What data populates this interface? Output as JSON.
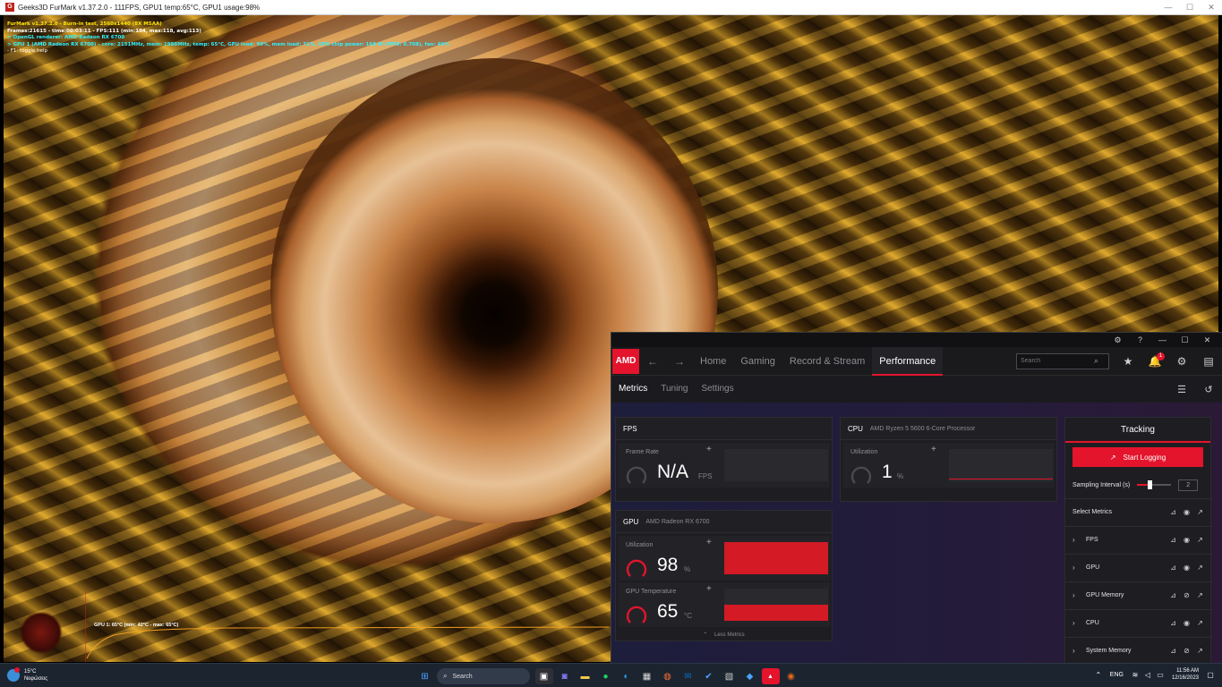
{
  "furmark": {
    "title": "Geeks3D FurMark v1.37.2.0 - 111FPS, GPU1 temp:65°C, GPU1 usage:98%",
    "hud": [
      "FurMark v1.37.2.0 - Burn-in test, 2560x1440 (8X MSAA)",
      "Frames:21615 - time:00:03:11 - FPS:111 (min:104, max:118, avg:113)",
      "> OpenGL renderer: AMD Radeon RX 6700",
      "> GPU 1 (AMD Radeon RX 6700) - core: 2151MHz, mem: 1988MHz, temp: 65°C, GPU load: 99%, mem load: 71%, GPU chip power: 168 W (PPW: 0.708), fan: 49%",
      "- F1: toggle help"
    ],
    "graph_caption": "GPU 1: 65°C (min: 42°C - max: 65°C)"
  },
  "amd": {
    "logo": "AMD",
    "nav": {
      "back": "←",
      "forward": "→",
      "tabs": [
        "Home",
        "Gaming",
        "Record & Stream",
        "Performance"
      ],
      "active_tab": "Performance",
      "search_placeholder": "Search",
      "notification_count": "1"
    },
    "subnav": {
      "tabs": [
        "Metrics",
        "Tuning",
        "Settings"
      ],
      "active_tab": "Metrics"
    },
    "fps_card": {
      "title": "FPS",
      "frame_rate_label": "Frame Rate",
      "frame_rate_value": "N/A",
      "frame_rate_unit": "FPS"
    },
    "cpu_card": {
      "title": "CPU",
      "subtitle": "AMD Ryzen 5 5600 6-Core Processor",
      "utilization_label": "Utilization",
      "utilization_value": "1",
      "utilization_unit": "%"
    },
    "gpu_card": {
      "title": "GPU",
      "subtitle": "AMD Radeon RX 6700",
      "utilization_label": "Utilization",
      "utilization_value": "98",
      "utilization_unit": "%",
      "temp_label": "GPU Temperature",
      "temp_value": "65",
      "temp_unit": "°C",
      "less_metrics": "Less Metrics"
    },
    "tracking": {
      "title": "Tracking",
      "start_logging": "Start Logging",
      "sampling_label": "Sampling Interval (s)",
      "sampling_value": "2",
      "select_metrics": "Select Metrics",
      "rows": [
        "FPS",
        "GPU",
        "GPU Memory",
        "CPU",
        "System Memory"
      ]
    },
    "accent_color": "#e3142c"
  },
  "taskbar": {
    "weather_temp": "15°C",
    "weather_desc": "Νεφώσεις",
    "search_label": "Search",
    "language": "ENG",
    "time": "11:56 AM",
    "date": "12/16/2023"
  }
}
